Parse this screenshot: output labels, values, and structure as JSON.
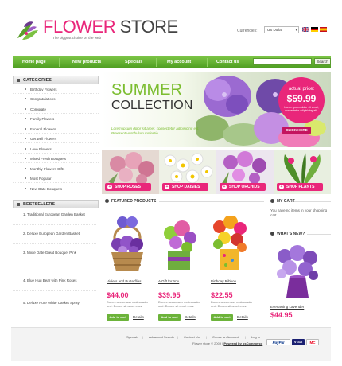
{
  "header": {
    "store_name_accent": "FLOWER",
    "store_name_rest": " STORE",
    "slogan": "The biggest choice on the web",
    "currency_label": "Currencies:",
    "currency_value": "US Dollar"
  },
  "nav": {
    "items": [
      "Home page",
      "New products",
      "Specials",
      "My account",
      "Contact us"
    ],
    "search_button": "Search"
  },
  "sidebar": {
    "categories_title": "CATEGORIES",
    "categories": [
      "Birthday Flowers",
      "Congratulations",
      "Corporate",
      "Family Flowers",
      "Funeral Flowers",
      "Get well Flowers",
      "Love Flowers",
      "Mixed Fresh Bouquets",
      "Monthly Flowers Gifts",
      "Most Popular",
      "New Date Bouquets"
    ],
    "bestsellers_title": "BESTSELLERS",
    "bestsellers": [
      "1. Traditional European Garden Basket",
      "2. Deluxe European Garden Basket",
      "3. Mixte Date Great Bouquet Pink",
      "4. Blue Hug Bear with Pink Roses",
      "5. Deluxe Pure White Casket Spray"
    ]
  },
  "banner": {
    "title_line1": "SUMMER",
    "title_line2": "COLLECTION",
    "text": "Lorem ipsum dolor sit amet, consectetur adipisicing elit. Praesent vestibulum molestie",
    "price_label": "actual price:",
    "price_value": "$59.99",
    "price_sub": "Lorem ipsum dolor sit amet, consectetur adipisicing elit.",
    "cta": "CLICK HERE"
  },
  "shop_tiles": [
    "SHOP ROSES",
    "SHOP DAISIES",
    "SHOP ORCHIDS",
    "SHOP PLANTS"
  ],
  "featured": {
    "title": "FEATURED PRODUCTS",
    "products": [
      {
        "name": "Violets and Butterflies",
        "price": "$44.00",
        "desc": "Donec accumsan malesuada orci. Donec sit amet eros.",
        "add": "Add to cart",
        "details": "Details"
      },
      {
        "name": "A Gift for You",
        "price": "$39.95",
        "desc": "Donec accumsan malesuada orci. Donec sit amet eros.",
        "add": "Add to cart",
        "details": "Details"
      },
      {
        "name": "Birthday Ribbon",
        "price": "$22.55",
        "desc": "Donec accumsan malesuada orci. Donec sit amet eros.",
        "add": "Add to cart",
        "details": "Details"
      }
    ]
  },
  "cart": {
    "title": "MY CART",
    "text": "You have no items in your shopping cart."
  },
  "whats_new": {
    "title": "WHAT'S NEW?",
    "name": "Everlasting Lavender",
    "price": "$44.95"
  },
  "footer": {
    "links": [
      "Specials",
      "Advanced Search",
      "Contact Us",
      "Create an Account",
      "Log In"
    ],
    "copy": "Flower store © 2009",
    "powered": "Powered by osCommerce",
    "payments": [
      "PayPal",
      "VISA",
      "MC"
    ]
  },
  "colors": {
    "accent_pink": "#e9267a",
    "nav_green": "#5cae2b",
    "title_green": "#7bbd2f"
  }
}
